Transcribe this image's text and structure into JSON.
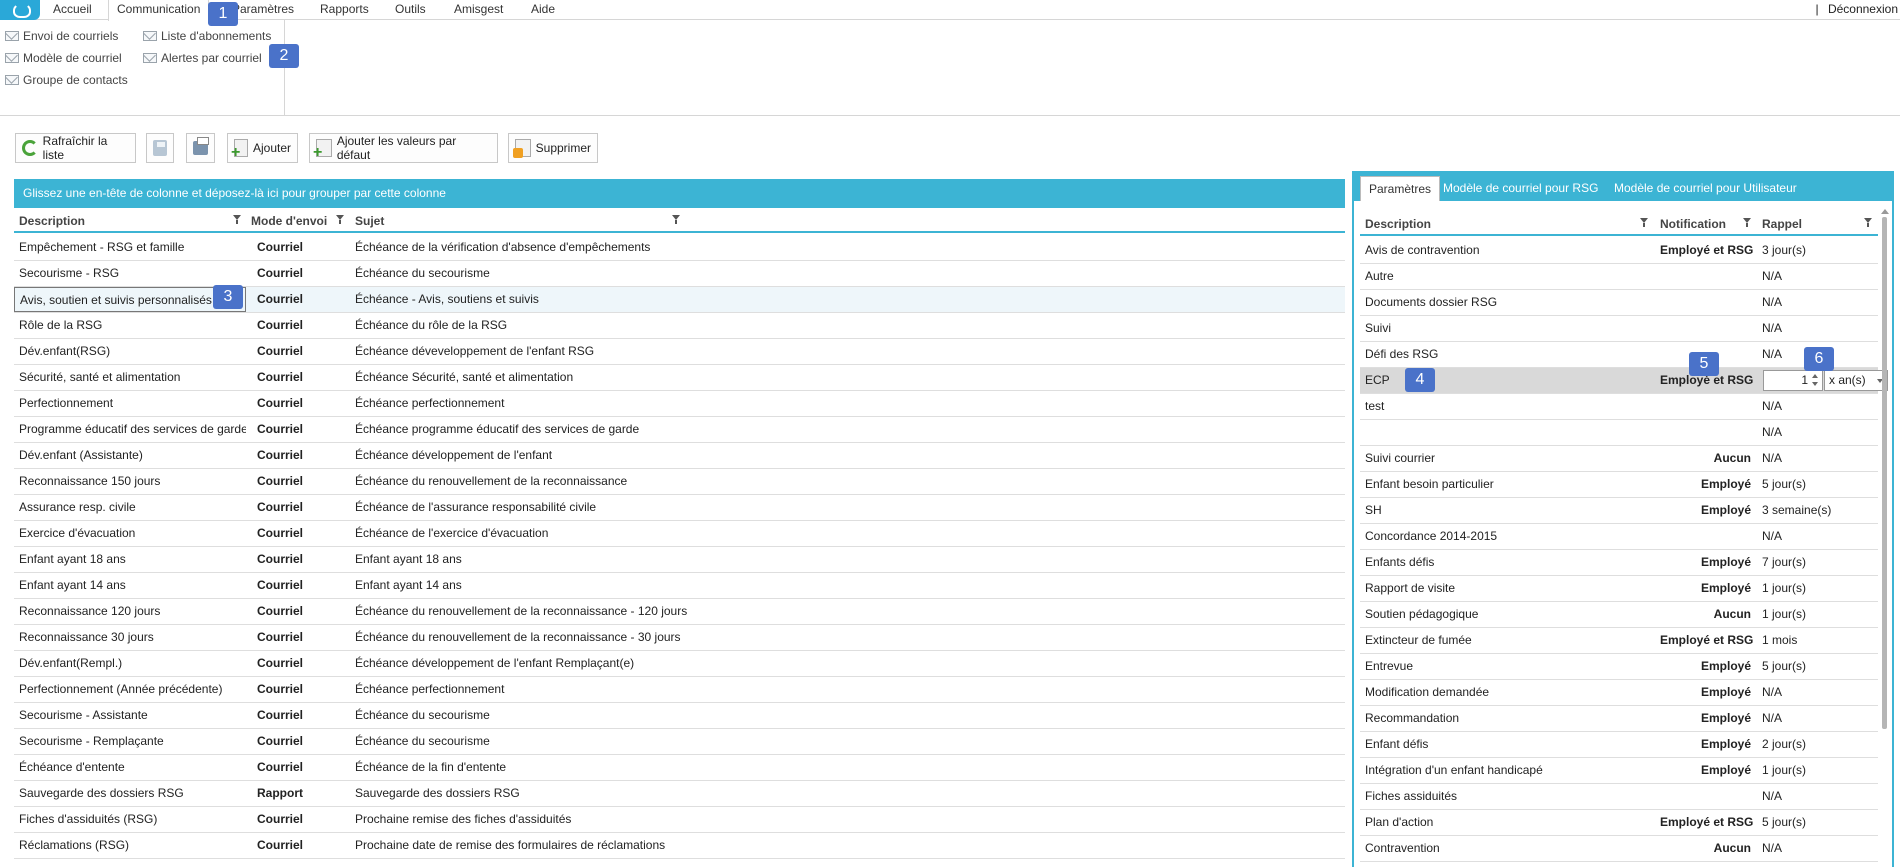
{
  "menu": {
    "items": [
      "Accueil",
      "Communication",
      "Paramètres",
      "Rapports",
      "Outils",
      "Amisgest",
      "Aide"
    ],
    "logout_sep": "|",
    "logout": "Déconnexion"
  },
  "ribbon": {
    "items": [
      "Envoi de courriels",
      "Modèle de courriel",
      "Groupe de contacts",
      "Liste d'abonnements",
      "Alertes par courriel"
    ]
  },
  "toolbar": {
    "refresh": "Rafraîchir la liste",
    "add": "Ajouter",
    "add_defaults": "Ajouter les valeurs par défaut",
    "delete": "Supprimer"
  },
  "left_grid": {
    "group_hint": "Glissez une en-tête de colonne et déposez-là ici pour grouper par cette colonne",
    "columns": [
      "Description",
      "Mode d'envoi",
      "Sujet"
    ],
    "rows": [
      [
        "Empêchement - RSG et famille",
        "Courriel",
        "Échéance de la vérification d'absence d'empêchements"
      ],
      [
        "Secourisme - RSG",
        "Courriel",
        "Échéance du secourisme"
      ],
      [
        "Avis, soutien et suivis personnalisés",
        "Courriel",
        "Échéance - Avis, soutiens et suivis"
      ],
      [
        "Rôle de la RSG",
        "Courriel",
        "Échéance du rôle de la RSG"
      ],
      [
        "Dév.enfant(RSG)",
        "Courriel",
        "Échéance déveveloppement de l'enfant RSG"
      ],
      [
        "Sécurité, santé et alimentation",
        "Courriel",
        "Échéance Sécurité, santé et alimentation"
      ],
      [
        "Perfectionnement",
        "Courriel",
        "Échéance perfectionnement"
      ],
      [
        "Programme éducatif des services de garde",
        "Courriel",
        "Échéance programme éducatif des services de garde"
      ],
      [
        "Dév.enfant (Assistante)",
        "Courriel",
        "Échéance développement de l'enfant"
      ],
      [
        "Reconnaissance 150 jours",
        "Courriel",
        "Échéance du renouvellement de la reconnaissance"
      ],
      [
        "Assurance resp. civile",
        "Courriel",
        "Échéance de l'assurance responsabilité civile"
      ],
      [
        "Exercice d'évacuation",
        "Courriel",
        "Échéance de l'exercice d'évacuation"
      ],
      [
        "Enfant ayant 18 ans",
        "Courriel",
        "Enfant ayant 18 ans"
      ],
      [
        "Enfant ayant 14 ans",
        "Courriel",
        "Enfant ayant 14 ans"
      ],
      [
        "Reconnaissance 120 jours",
        "Courriel",
        "Échéance du renouvellement de la reconnaissance - 120 jours"
      ],
      [
        "Reconnaissance 30 jours",
        "Courriel",
        "Échéance du renouvellement de la reconnaissance - 30 jours"
      ],
      [
        "Dév.enfant(Rempl.)",
        "Courriel",
        "Échéance développement de l'enfant Remplaçant(e)"
      ],
      [
        "Perfectionnement (Année précédente)",
        "Courriel",
        "Échéance perfectionnement"
      ],
      [
        "Secourisme - Assistante",
        "Courriel",
        "Échéance du secourisme"
      ],
      [
        "Secourisme - Remplaçante",
        "Courriel",
        "Échéance du secourisme"
      ],
      [
        "Échéance d'entente",
        "Courriel",
        "Échéance de la fin d'entente"
      ],
      [
        "Sauvegarde des dossiers RSG",
        "Rapport",
        "Sauvegarde des dossiers RSG"
      ],
      [
        "Fiches d'assiduités (RSG)",
        "Courriel",
        "Prochaine remise des fiches d'assiduités"
      ],
      [
        "Réclamations (RSG)",
        "Courriel",
        "Prochaine date de remise des formulaires de réclamations"
      ]
    ],
    "selected_row": 2
  },
  "right_panel": {
    "tabs": [
      "Paramètres",
      "Modèle de courriel pour RSG",
      "Modèle de courriel pour Utilisateur"
    ],
    "columns": [
      "Description",
      "Notification",
      "Rappel"
    ],
    "rows": [
      [
        "Avis de contravention",
        "Employé et RSG",
        "3 jour(s)"
      ],
      [
        "Autre",
        "",
        "N/A"
      ],
      [
        "Documents dossier RSG",
        "",
        "N/A"
      ],
      [
        "Suivi",
        "",
        "N/A"
      ],
      [
        "Défi des RSG",
        "",
        "N/A"
      ],
      [
        "ECP",
        "Employé et RSG",
        ""
      ],
      [
        "test",
        "",
        "N/A"
      ],
      [
        "",
        "",
        "N/A"
      ],
      [
        "Suivi courrier",
        "Aucun",
        "N/A"
      ],
      [
        "Enfant besoin particulier",
        "Employé",
        "5 jour(s)"
      ],
      [
        "SH",
        "Employé",
        "3 semaine(s)"
      ],
      [
        "Concordance 2014-2015",
        "",
        "N/A"
      ],
      [
        "Enfants défis",
        "Employé",
        "7 jour(s)"
      ],
      [
        "Rapport de visite",
        "Employé",
        "1 jour(s)"
      ],
      [
        "Soutien pédagogique",
        "Aucun",
        "1 jour(s)"
      ],
      [
        "Extincteur de fumée",
        "Employé et RSG",
        "1 mois"
      ],
      [
        "Entrevue",
        "Employé",
        "5 jour(s)"
      ],
      [
        "Modification demandée",
        "Employé",
        "N/A"
      ],
      [
        "Recommandation",
        "Employé",
        "N/A"
      ],
      [
        "Enfant défis",
        "Employé",
        "2 jour(s)"
      ],
      [
        "Intégration d'un enfant handicapé",
        "Employé",
        "1 jour(s)"
      ],
      [
        "Fiches assiduités",
        "",
        "N/A"
      ],
      [
        "Plan d'action",
        "Employé et RSG",
        "5 jour(s)"
      ],
      [
        "Contravention",
        "Aucun",
        "N/A"
      ]
    ],
    "editing_row": 5,
    "editor": {
      "value": "1",
      "unit": "x an(s)"
    }
  },
  "markers": [
    "1",
    "2",
    "3",
    "4",
    "5",
    "6"
  ],
  "colors": {
    "accent": "#3cb4d4",
    "marker": "#4a72c9",
    "logo": "#2aa8d8"
  }
}
